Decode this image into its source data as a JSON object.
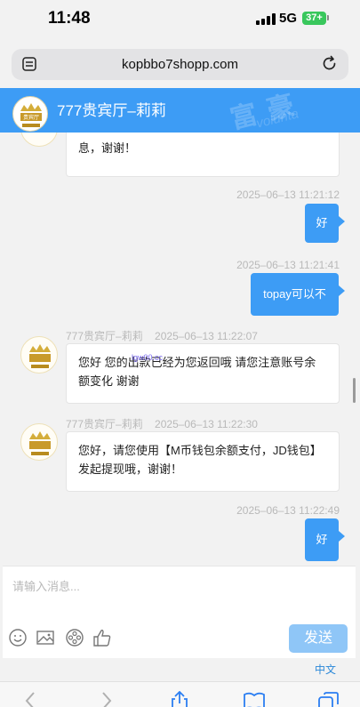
{
  "status_bar": {
    "time": "11:48",
    "network": "5G",
    "battery": "37+"
  },
  "browser": {
    "url": "kopbbo7shopp.com"
  },
  "chat": {
    "title": "777贵宾厅–莉莉",
    "avatar_text": "贵宾厅",
    "messages": [
      {
        "dir": "in",
        "text": "息，谢谢！"
      },
      {
        "dir": "out",
        "time": "2025–06–13 11:21:12",
        "text": "好"
      },
      {
        "dir": "out",
        "time": "2025–06–13 11:21:41",
        "text": "topay可以不"
      },
      {
        "dir": "in",
        "sender": "777贵宾厅–莉莉",
        "time": "2025–06–13 11:22:07",
        "text": "您好 您的出款已经为您返回哦 请您注意账号余额变化  谢谢"
      },
      {
        "dir": "in",
        "sender": "777贵宾厅–莉莉",
        "time": "2025–06–13 11:22:30",
        "text": "您好，请您使用【M币钱包余额支付，JD钱包】发起提现哦，谢谢！"
      },
      {
        "dir": "out",
        "time": "2025–06–13 11:22:49",
        "text": "好"
      }
    ],
    "overlay_link": "lgw00.cc"
  },
  "input": {
    "placeholder": "请输入消息...",
    "send_label": "发送"
  },
  "language": {
    "label": "中文"
  },
  "colors": {
    "accent": "#3d9cf5",
    "send_disabled": "#8fc6f7",
    "background": "#f2f2f2"
  }
}
